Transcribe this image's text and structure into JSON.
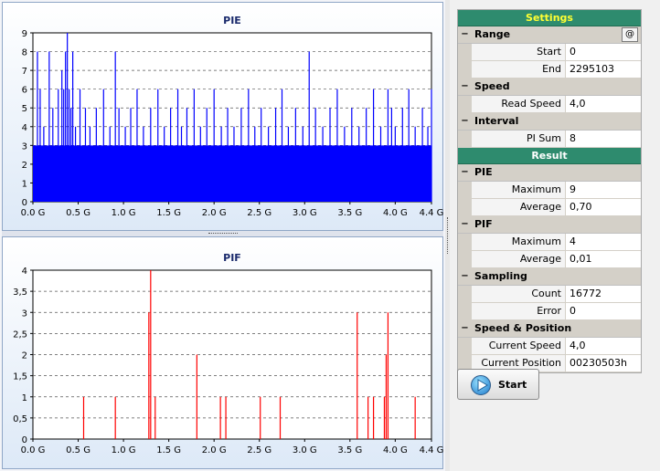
{
  "charts": {
    "pie": {
      "chart_data": {
        "type": "bar",
        "title": "PIE",
        "xlabel": "",
        "ylabel": "",
        "x_ticks": [
          "0.0 G",
          "0.5 G",
          "1.0 G",
          "1.5 G",
          "2.0 G",
          "2.5 G",
          "3.0 G",
          "3.5 G",
          "4.0 G",
          "4.4 G"
        ],
        "y_ticks": [
          "0",
          "1",
          "2",
          "3",
          "4",
          "5",
          "6",
          "7",
          "8",
          "9"
        ],
        "xlim": [
          0,
          4.4
        ],
        "ylim": [
          0,
          9
        ],
        "grid": true,
        "color": "#0000ff",
        "baseline": {
          "x": [
            0.0,
            4.4
          ],
          "y": 3
        },
        "spikes": {
          "x": [
            0.05,
            0.08,
            0.12,
            0.18,
            0.22,
            0.28,
            0.32,
            0.34,
            0.36,
            0.38,
            0.4,
            0.42,
            0.44,
            0.47,
            0.52,
            0.58,
            0.63,
            0.7,
            0.78,
            0.85,
            0.91,
            0.95,
            1.02,
            1.08,
            1.15,
            1.22,
            1.3,
            1.38,
            1.45,
            1.52,
            1.6,
            1.64,
            1.7,
            1.78,
            1.85,
            1.92,
            2.0,
            2.08,
            2.15,
            2.22,
            2.3,
            2.38,
            2.45,
            2.52,
            2.6,
            2.68,
            2.75,
            2.82,
            2.9,
            2.98,
            3.05,
            3.12,
            3.2,
            3.28,
            3.36,
            3.44,
            3.52,
            3.6,
            3.68,
            3.76,
            3.84,
            3.92,
            3.96,
            4.0,
            4.08,
            4.15,
            4.22,
            4.3,
            4.36,
            4.4
          ],
          "y": [
            8,
            6,
            4,
            8,
            5,
            6,
            7,
            6,
            8,
            9,
            6,
            5,
            8,
            4,
            6,
            5,
            4,
            5,
            6,
            4,
            8,
            5,
            4,
            5,
            6,
            4,
            5,
            6,
            4,
            5,
            6,
            4,
            5,
            6,
            4,
            5,
            6,
            4,
            5,
            4,
            5,
            6,
            4,
            5,
            4,
            5,
            6,
            4,
            5,
            4,
            8,
            5,
            4,
            5,
            6,
            4,
            5,
            4,
            5,
            6,
            4,
            6,
            5,
            4,
            5,
            6,
            4,
            5,
            4,
            6
          ]
        }
      }
    },
    "pif": {
      "chart_data": {
        "type": "bar",
        "title": "PIF",
        "xlabel": "",
        "ylabel": "",
        "x_ticks": [
          "0.0 G",
          "0.5 G",
          "1.0 G",
          "1.5 G",
          "2.0 G",
          "2.5 G",
          "3.0 G",
          "3.5 G",
          "4.0 G",
          "4.4 G"
        ],
        "y_ticks": [
          "0",
          "0,5",
          "1",
          "1,5",
          "2",
          "2,5",
          "3",
          "3,5",
          "4"
        ],
        "xlim": [
          0,
          4.4
        ],
        "ylim": [
          0,
          4
        ],
        "grid": true,
        "color": "#ff0000",
        "spikes": {
          "x": [
            0.56,
            0.91,
            1.28,
            1.3,
            1.35,
            1.81,
            2.07,
            2.13,
            2.51,
            2.73,
            3.58,
            3.7,
            3.76,
            3.88,
            3.9,
            3.92,
            4.22
          ],
          "y": [
            1,
            1,
            3,
            4,
            1,
            2,
            1,
            1,
            1,
            1,
            3,
            1,
            1,
            1,
            2,
            3,
            1
          ]
        }
      }
    }
  },
  "settings": {
    "title": "Settings",
    "at_button": "@",
    "categories": [
      {
        "label": "Range",
        "toggle": "−",
        "rows": [
          {
            "k": "Start",
            "v": "0"
          },
          {
            "k": "End",
            "v": "2295103"
          }
        ]
      },
      {
        "label": "Speed",
        "toggle": "−",
        "rows": [
          {
            "k": "Read Speed",
            "v": "4,0"
          }
        ]
      },
      {
        "label": "Interval",
        "toggle": "−",
        "rows": [
          {
            "k": "PI Sum",
            "v": "8"
          }
        ]
      }
    ]
  },
  "result": {
    "title": "Result",
    "categories": [
      {
        "label": "PIE",
        "toggle": "−",
        "rows": [
          {
            "k": "Maximum",
            "v": "9"
          },
          {
            "k": "Average",
            "v": "0,70"
          }
        ]
      },
      {
        "label": "PIF",
        "toggle": "−",
        "rows": [
          {
            "k": "Maximum",
            "v": "4"
          },
          {
            "k": "Average",
            "v": "0,01"
          }
        ]
      },
      {
        "label": "Sampling",
        "toggle": "−",
        "rows": [
          {
            "k": "Count",
            "v": "16772"
          },
          {
            "k": "Error",
            "v": "0"
          }
        ]
      },
      {
        "label": "Speed & Position",
        "toggle": "−",
        "rows": [
          {
            "k": "Current Speed",
            "v": "4,0"
          },
          {
            "k": "Current Position",
            "v": "00230503h"
          }
        ]
      }
    ]
  },
  "start_button": {
    "label": "Start",
    "icon": "play-icon"
  }
}
